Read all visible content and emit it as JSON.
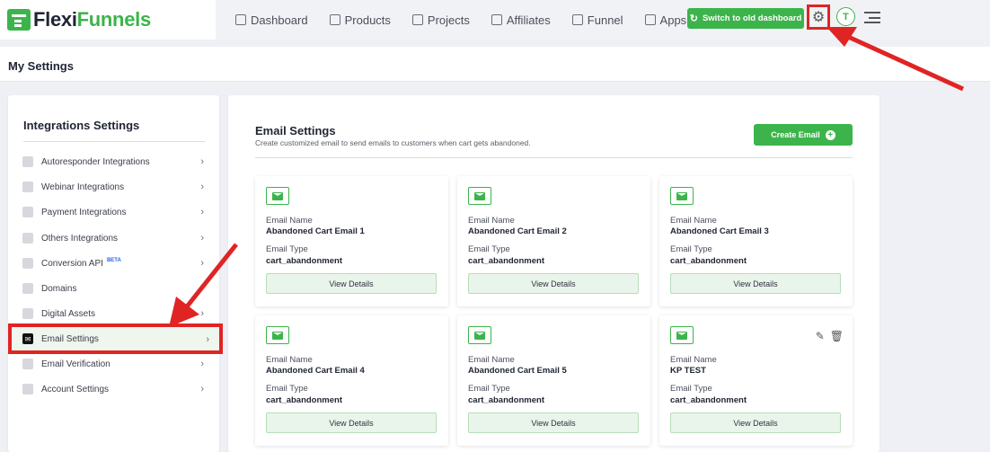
{
  "header": {
    "logo_flexi": "Flexi",
    "logo_funnels": "Funnels",
    "nav": [
      {
        "label": "Dashboard",
        "icon": "grid-icon"
      },
      {
        "label": "Products",
        "icon": "store-icon"
      },
      {
        "label": "Projects",
        "icon": "document-icon"
      },
      {
        "label": "Affiliates",
        "icon": "handshake-icon"
      },
      {
        "label": "Funnel",
        "icon": "funnel-icon"
      },
      {
        "label": "Apps",
        "icon": "apps-icon"
      }
    ],
    "switch_label": "Switch to old dashboard",
    "avatar_initial": "T"
  },
  "page": {
    "title": "My Settings"
  },
  "sidebar": {
    "title": "Integrations Settings",
    "items": [
      {
        "label": "Autoresponder Integrations",
        "icon": "user-icon"
      },
      {
        "label": "Webinar Integrations",
        "icon": "video-icon"
      },
      {
        "label": "Payment Integrations",
        "icon": "dollar-icon"
      },
      {
        "label": "Others Integrations",
        "icon": "document-icon"
      },
      {
        "label": "Conversion API",
        "icon": "document-icon",
        "badge": "BETA"
      },
      {
        "label": "Domains",
        "icon": "globe-icon"
      },
      {
        "label": "Digital Assets",
        "icon": "gift-icon"
      },
      {
        "label": "Email Settings",
        "icon": "mail-icon",
        "active": true
      },
      {
        "label": "Email Verification",
        "icon": "mail-check-icon"
      },
      {
        "label": "Account Settings",
        "icon": "gear-icon"
      }
    ]
  },
  "main": {
    "title": "Email Settings",
    "subtitle": "Create customized email to send emails to customers when cart gets abandoned.",
    "create_label": "Create Email",
    "name_label": "Email Name",
    "type_label": "Email Type",
    "view_label": "View Details",
    "cards": [
      {
        "name": "Abandoned Cart Email 1",
        "type": "cart_abandonment"
      },
      {
        "name": "Abandoned Cart Email 2",
        "type": "cart_abandonment"
      },
      {
        "name": "Abandoned Cart Email 3",
        "type": "cart_abandonment"
      },
      {
        "name": "Abandoned Cart Email 4",
        "type": "cart_abandonment"
      },
      {
        "name": "Abandoned Cart Email 5",
        "type": "cart_abandonment"
      },
      {
        "name": "KP TEST",
        "type": "cart_abandonment",
        "editable": true
      }
    ]
  },
  "colors": {
    "brand_green": "#3cb44b",
    "highlight_red": "#e02424"
  }
}
